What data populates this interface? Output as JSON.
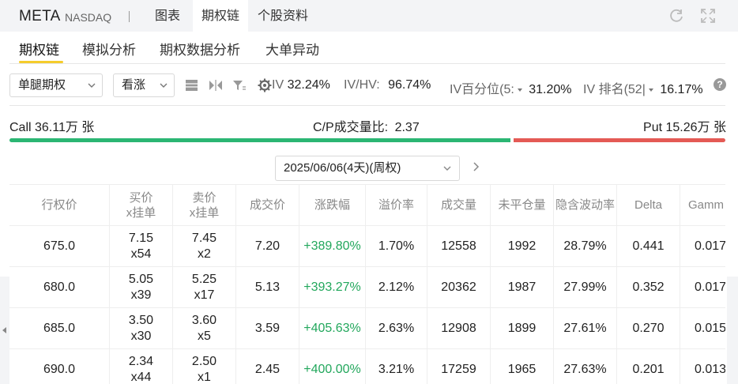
{
  "header": {
    "ticker": "META",
    "exchange": "NASDAQ",
    "tabs": [
      "图表",
      "期权链",
      "个股资料"
    ]
  },
  "subtabs": [
    "期权链",
    "模拟分析",
    "期权数据分析",
    "大单异动"
  ],
  "filters": {
    "leg_type": "单腿期权",
    "direction": "看涨",
    "iv_label": "IV",
    "iv_value": "32.24%",
    "ivhv_label": "IV/HV:",
    "ivhv_value": "96.74%",
    "iv_pct_label": "IV百分位(5:",
    "iv_pct_value": "31.20%",
    "iv_rank_label": "IV 排名(52|",
    "iv_rank_value": "16.17%",
    "help": "?"
  },
  "volume": {
    "call_label": "Call 36.11万 张",
    "ratio_label": "C/P成交量比:",
    "ratio_value": "2.37",
    "put_label": "Put 15.26万 张",
    "call_share": 0.703
  },
  "expiry": {
    "selected": "2025/06/06(4天)(周权)"
  },
  "table": {
    "headers": [
      [
        "行权价"
      ],
      [
        "买价",
        "x挂单"
      ],
      [
        "卖价",
        "x挂单"
      ],
      [
        "成交价"
      ],
      [
        "涨跌幅"
      ],
      [
        "溢价率"
      ],
      [
        "成交量"
      ],
      [
        "未平仓量"
      ],
      [
        "隐含波动率"
      ],
      [
        "Delta"
      ],
      [
        "Gamm"
      ]
    ],
    "rows": [
      {
        "strike": "675.0",
        "bid": "7.15",
        "bid_size": "x54",
        "ask": "7.45",
        "ask_size": "x2",
        "last": "7.20",
        "change": "+389.80%",
        "premium": "1.70%",
        "volume": "12558",
        "oi": "1992",
        "iv": "28.79%",
        "delta": "0.441",
        "gamma": "0.017"
      },
      {
        "strike": "680.0",
        "bid": "5.05",
        "bid_size": "x39",
        "ask": "5.25",
        "ask_size": "x17",
        "last": "5.13",
        "change": "+393.27%",
        "premium": "2.12%",
        "volume": "20362",
        "oi": "1987",
        "iv": "27.99%",
        "delta": "0.352",
        "gamma": "0.017"
      },
      {
        "strike": "685.0",
        "bid": "3.50",
        "bid_size": "x30",
        "ask": "3.60",
        "ask_size": "x5",
        "last": "3.59",
        "change": "+405.63%",
        "premium": "2.63%",
        "volume": "12908",
        "oi": "1899",
        "iv": "27.61%",
        "delta": "0.270",
        "gamma": "0.015"
      },
      {
        "strike": "690.0",
        "bid": "2.34",
        "bid_size": "x44",
        "ask": "2.50",
        "ask_size": "x1",
        "last": "2.45",
        "change": "+400.00%",
        "premium": "3.21%",
        "volume": "17259",
        "oi": "1965",
        "iv": "27.63%",
        "delta": "0.201",
        "gamma": "0.013"
      }
    ]
  },
  "colors": {
    "up": "#22a75c",
    "call_bar": "#2bb673",
    "put_bar": "#e45a55",
    "accent": "#f5cc2c"
  },
  "icons": [
    "refresh-icon",
    "fullscreen-icon",
    "table-icon",
    "compare-icon",
    "filter-icon",
    "gear-icon",
    "chevron-down-icon",
    "chevron-right-icon",
    "help-icon"
  ]
}
